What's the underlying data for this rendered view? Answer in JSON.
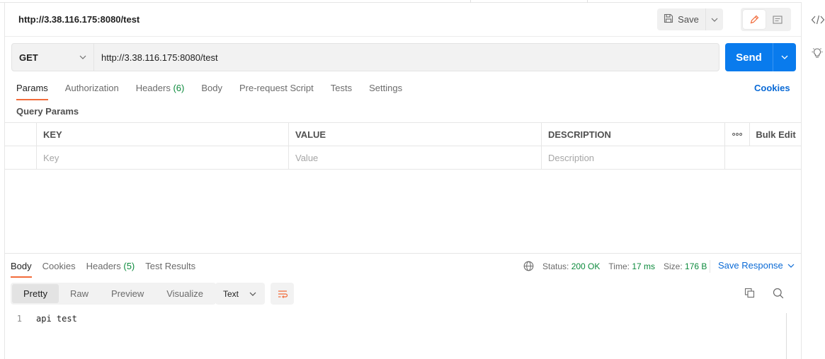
{
  "request": {
    "title": "http://3.38.116.175:8080/test",
    "method": "GET",
    "url": "http://3.38.116.175:8080/test",
    "save_label": "Save",
    "send_label": "Send"
  },
  "request_tabs": [
    {
      "label": "Params",
      "active": true
    },
    {
      "label": "Authorization"
    },
    {
      "label": "Headers",
      "count": "(6)"
    },
    {
      "label": "Body"
    },
    {
      "label": "Pre-request Script"
    },
    {
      "label": "Tests"
    },
    {
      "label": "Settings"
    }
  ],
  "cookies_link": "Cookies",
  "query_params": {
    "title": "Query Params",
    "columns": {
      "key": "KEY",
      "value": "VALUE",
      "description": "DESCRIPTION",
      "bulk_edit": "Bulk Edit",
      "more": "ooo"
    },
    "placeholders": {
      "key": "Key",
      "value": "Value",
      "description": "Description"
    }
  },
  "response": {
    "tabs": [
      {
        "label": "Body",
        "active": true
      },
      {
        "label": "Cookies"
      },
      {
        "label": "Headers",
        "count": "(5)"
      },
      {
        "label": "Test Results"
      }
    ],
    "status_label": "Status:",
    "status_value": "200 OK",
    "time_label": "Time:",
    "time_value": "17 ms",
    "size_label": "Size:",
    "size_value": "176 B",
    "save_response": "Save Response",
    "views": [
      "Pretty",
      "Raw",
      "Preview",
      "Visualize"
    ],
    "format": "Text",
    "lines": [
      {
        "no": "1",
        "text": "api test"
      }
    ]
  },
  "colors": {
    "accent": "#f26b3a",
    "primary": "#097bed",
    "success": "#0c8a3c",
    "link": "#0a6ad6"
  }
}
